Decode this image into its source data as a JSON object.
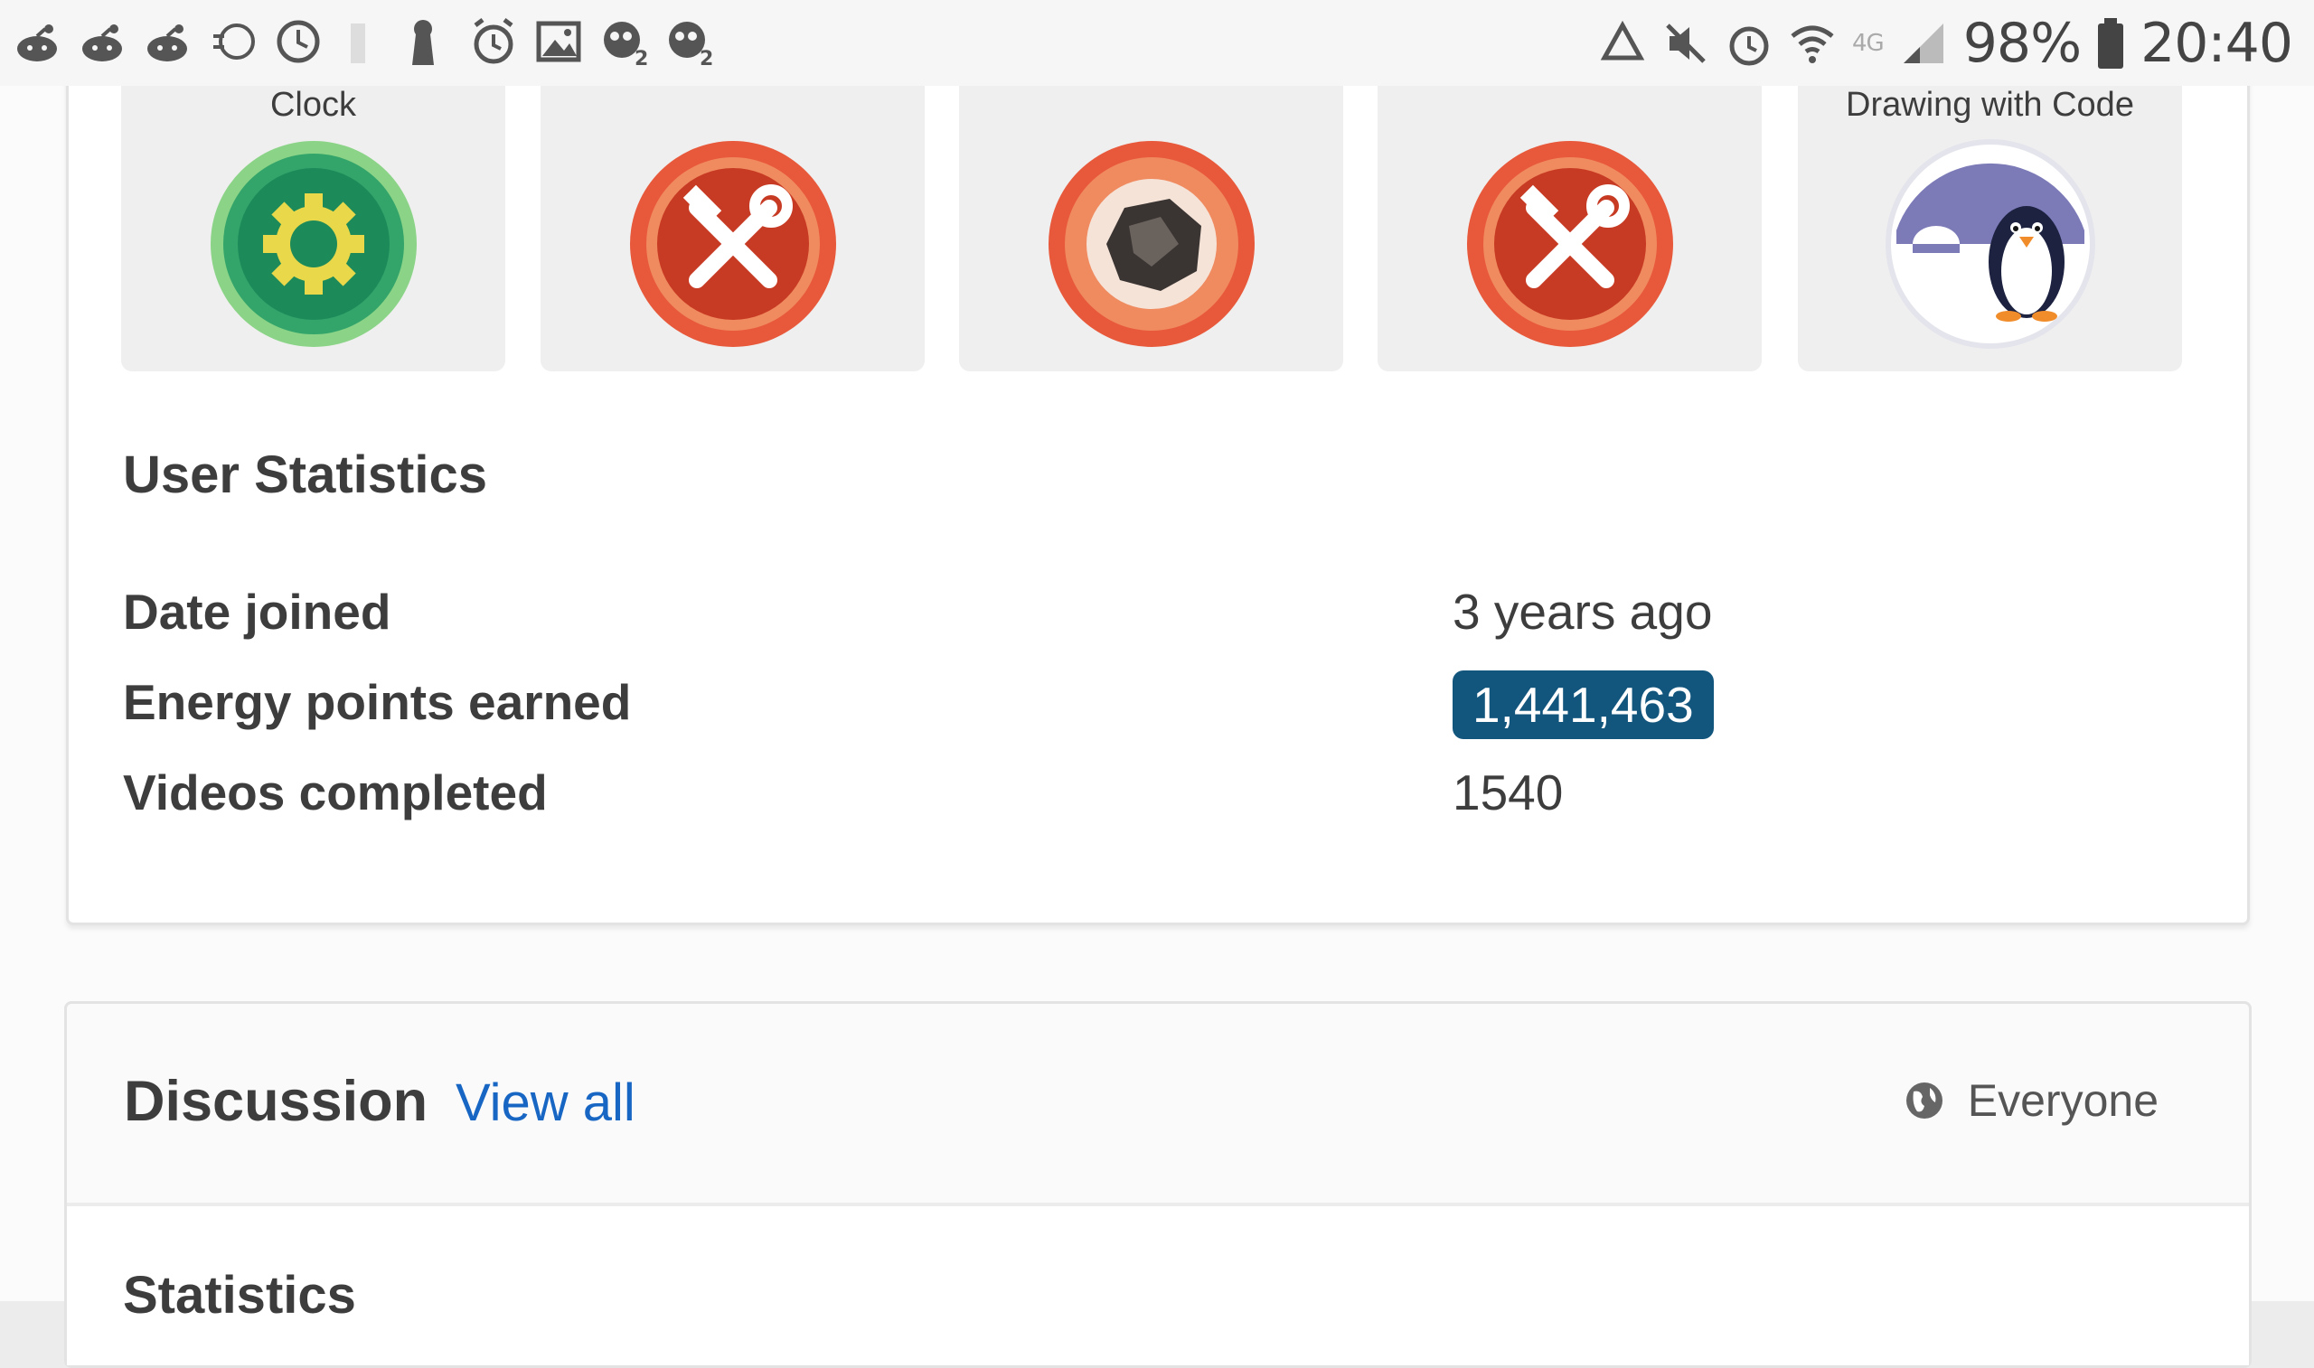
{
  "status_bar": {
    "battery_text": "98%",
    "time": "20:40",
    "network_label": "4G"
  },
  "badges": [
    {
      "title": "Clock",
      "icon": "gear-badge-icon",
      "color": "#2e9a5c"
    },
    {
      "title": "",
      "icon": "tools-badge-icon",
      "color": "#d94b2e"
    },
    {
      "title": "",
      "icon": "rock-badge-icon",
      "color": "#d94b2e"
    },
    {
      "title": "",
      "icon": "tools-badge-icon",
      "color": "#d94b2e"
    },
    {
      "title": "Drawing with Code",
      "icon": "penguin-badge-icon",
      "color": "#7c7bb8"
    }
  ],
  "user_statistics": {
    "heading": "User Statistics",
    "rows": [
      {
        "label": "Date joined",
        "value": "3 years ago"
      },
      {
        "label": "Energy points earned",
        "value": "1,441,463"
      },
      {
        "label": "Videos completed",
        "value": "1540"
      }
    ]
  },
  "discussion": {
    "title": "Discussion",
    "view_all": "View all",
    "visibility": "Everyone"
  },
  "statistics_heading": "Statistics",
  "colors": {
    "accent_link": "#1866c4",
    "points_pill": "#12567e"
  }
}
